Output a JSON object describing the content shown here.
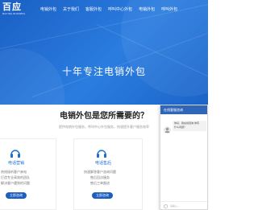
{
  "logo": {
    "text": "百应",
    "subtitle": "BAIYING BUSINESS"
  },
  "nav": {
    "items": [
      "电销外包",
      "关于我们",
      "客服外包",
      "呼叫中心外包",
      "电销外包",
      "呼叫外包"
    ]
  },
  "hero": {
    "title": "十年专注电销外包"
  },
  "section": {
    "title": "电销外包是您所需要的？",
    "subtitle": "提供电销外包服务，呼叫中心外包服务，快速提升客户服务效率"
  },
  "cards": [
    {
      "title": "电话营销",
      "lines": [
        "热线接听客户来电",
        "打造专业高效的团队",
        "解决客户遇到的问题"
      ],
      "button": "立即咨询"
    },
    {
      "title": "电话售后",
      "lines": [
        "快速解答客户咨询问题",
        "售后回访服务",
        "售后工单跟进"
      ],
      "button": "立即咨询"
    }
  ],
  "chat": {
    "header": "在线客服咨询",
    "message_line1": "你好，我在线咨询 你有",
    "message_line2": "什么问题？",
    "input_placeholder": "请输入..."
  },
  "colors": {
    "hero": "#2b7de0",
    "button": "#1b5fbf",
    "accent": "#1a6fd0",
    "chat_header": "#2f66b8"
  }
}
